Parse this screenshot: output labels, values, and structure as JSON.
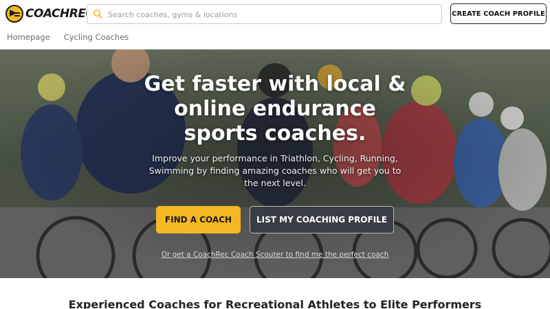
{
  "brand": {
    "name": "COACHREC"
  },
  "search": {
    "placeholder": "Search coaches, gyms & locations"
  },
  "header": {
    "create_profile_label": "CREATE COACH PROFILE"
  },
  "nav": {
    "items": [
      {
        "label": "Homepage"
      },
      {
        "label": "Cycling Coaches"
      }
    ]
  },
  "hero": {
    "title_lines": [
      "Get faster with local &",
      "online endurance",
      "sports coaches."
    ],
    "subtitle": "Improve your performance in Triathlon, Cycling, Running, Swimming by finding amazing coaches who will get you to the next level.",
    "find_coach_label": "FIND A COACH",
    "list_profile_label": "LIST MY COACHING PROFILE",
    "scout_link": "Or get a CoachRec Coach Scouter to find me the perfect coach"
  },
  "section": {
    "heading": "Experienced Coaches for Recreational Athletes to Elite Performers"
  },
  "colors": {
    "accent": "#f5b724",
    "dark_button": "#3a3d44"
  },
  "icons": {
    "logo": "cyclist-logo-icon",
    "search": "search-icon"
  }
}
